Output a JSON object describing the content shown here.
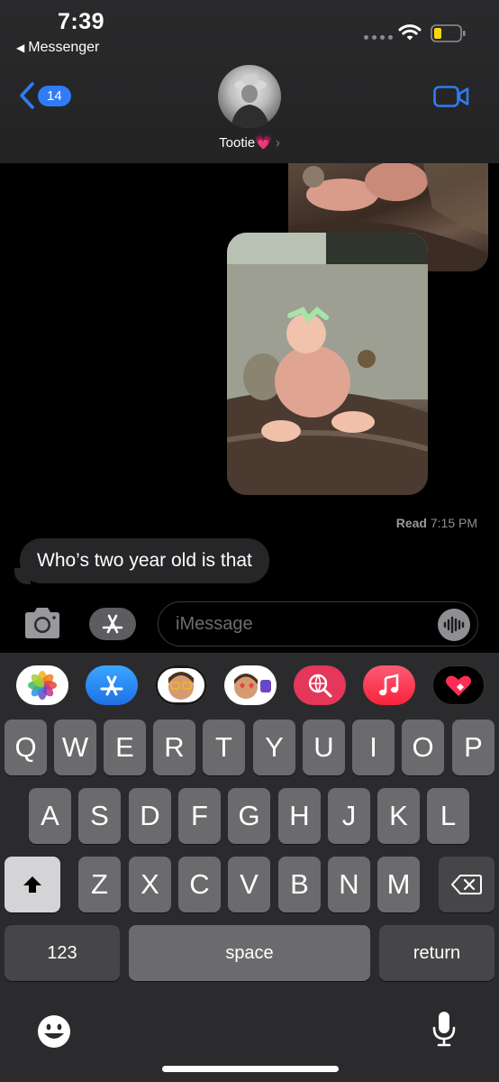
{
  "status_bar": {
    "time": "7:39",
    "back_app": "Messenger",
    "back_glyph": "◀"
  },
  "header": {
    "unread_count": "14",
    "contact_name": "Tootie",
    "contact_emoji": "💗",
    "contact_chevron": "›",
    "accent_color": "#2f7cf6"
  },
  "conversation": {
    "read_label": "Read",
    "read_time": "7:15 PM",
    "incoming_message": "Who’s two year old is that"
  },
  "input_bar": {
    "placeholder": "iMessage"
  },
  "app_drawer": [
    {
      "name": "photos"
    },
    {
      "name": "app-store"
    },
    {
      "name": "memoji"
    },
    {
      "name": "animoji"
    },
    {
      "name": "image-search"
    },
    {
      "name": "music"
    },
    {
      "name": "digital-touch"
    }
  ],
  "keyboard": {
    "row1": [
      "Q",
      "W",
      "E",
      "R",
      "T",
      "Y",
      "U",
      "I",
      "O",
      "P"
    ],
    "row2": [
      "A",
      "S",
      "D",
      "F",
      "G",
      "H",
      "J",
      "K",
      "L"
    ],
    "row3": [
      "Z",
      "X",
      "C",
      "V",
      "B",
      "N",
      "M"
    ],
    "numbers_key": "123",
    "space_key": "space",
    "return_key": "return"
  }
}
